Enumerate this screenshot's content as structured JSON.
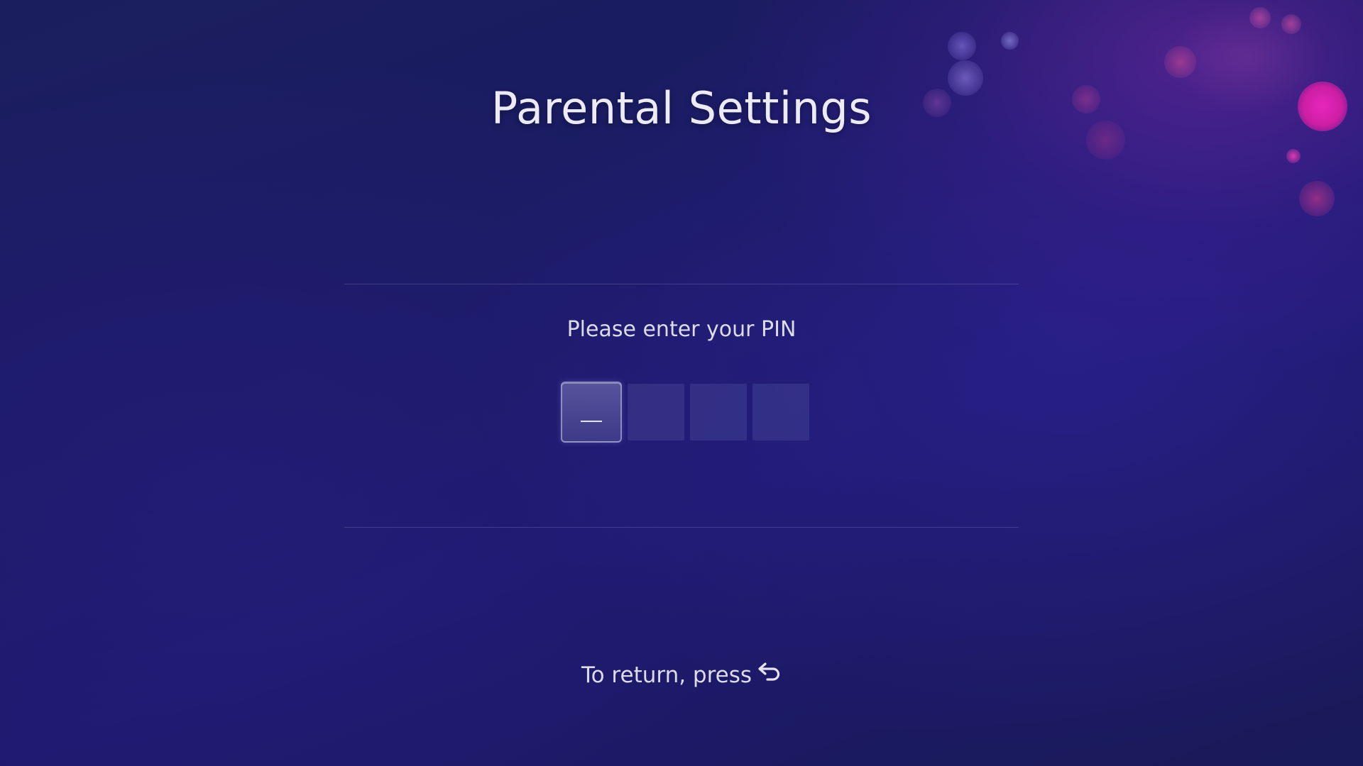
{
  "screen": {
    "title": "Parental Settings"
  },
  "pin_entry": {
    "prompt": "Please enter your PIN",
    "digits": [
      "",
      "",
      "",
      ""
    ],
    "active_index": 0
  },
  "footer": {
    "text": "To return, press",
    "icon": "back-arrow-icon"
  },
  "colors": {
    "background": "#1b1c62",
    "accent_magenta": "#e0289a",
    "text": "#e6e4f0"
  }
}
